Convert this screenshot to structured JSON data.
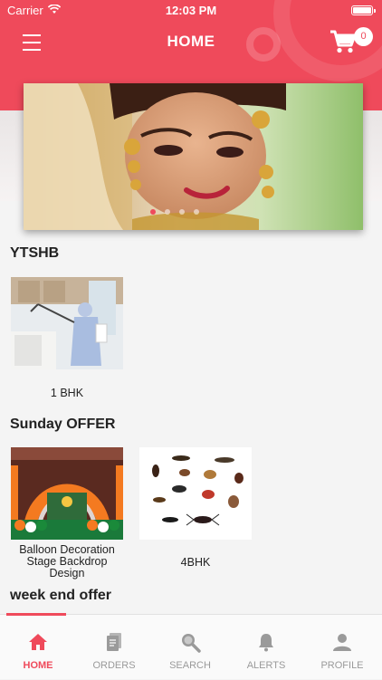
{
  "status": {
    "carrier": "Carrier",
    "time": "12:03 PM"
  },
  "header": {
    "title": "HOME",
    "cart_count": "0"
  },
  "banner": {
    "slide_count": 4,
    "active_slide": 1
  },
  "sections": [
    {
      "title": "YTSHB",
      "items": [
        {
          "label": "1 BHK",
          "image": "pest-control-sprayer"
        }
      ]
    },
    {
      "title": "Sunday OFFER",
      "items": [
        {
          "label": "Balloon Decoration Stage Backdrop Design",
          "image": "balloon-stage"
        },
        {
          "label": "4BHK",
          "image": "insects"
        }
      ]
    },
    {
      "title": "week end offer",
      "items": []
    }
  ],
  "tabs": [
    {
      "label": "HOME",
      "icon": "home-icon",
      "active": true
    },
    {
      "label": "ORDERS",
      "icon": "orders-icon",
      "active": false
    },
    {
      "label": "SEARCH",
      "icon": "search-icon",
      "active": false
    },
    {
      "label": "ALERTS",
      "icon": "bell-icon",
      "active": false
    },
    {
      "label": "PROFILE",
      "icon": "profile-icon",
      "active": false
    }
  ],
  "colors": {
    "accent": "#ef4a5b",
    "inactive": "#9a9a9a",
    "background": "#f4f4f4"
  }
}
